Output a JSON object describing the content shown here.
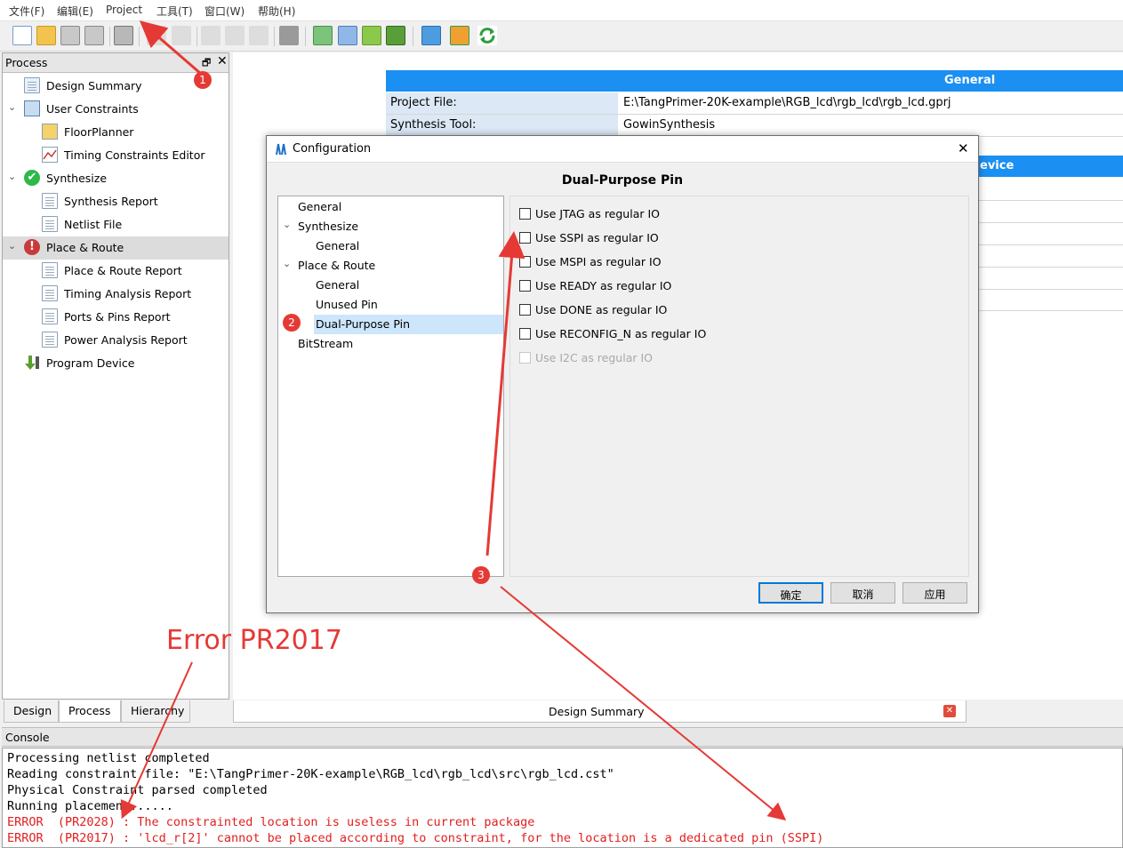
{
  "menu": [
    "文件(F)",
    "编辑(E)",
    "Project",
    "工具(T)",
    "窗口(W)",
    "帮助(H)"
  ],
  "process_panel": {
    "title": "Process",
    "items": [
      {
        "label": "Design Summary",
        "icon": "design-summary-icon"
      },
      {
        "label": "User Constraints",
        "icon": "constraints-icon"
      },
      {
        "label": "FloorPlanner",
        "icon": "floorplanner-icon"
      },
      {
        "label": "Timing Constraints Editor",
        "icon": "timing-editor-icon"
      },
      {
        "label": "Synthesize",
        "icon": "check-icon"
      },
      {
        "label": "Synthesis Report",
        "icon": "document-icon"
      },
      {
        "label": "Netlist File",
        "icon": "document-icon"
      },
      {
        "label": "Place & Route",
        "icon": "error-icon"
      },
      {
        "label": "Place & Route Report",
        "icon": "document-icon"
      },
      {
        "label": "Timing Analysis Report",
        "icon": "document-icon"
      },
      {
        "label": "Ports & Pins Report",
        "icon": "document-icon"
      },
      {
        "label": "Power Analysis Report",
        "icon": "document-icon"
      },
      {
        "label": "Program Device",
        "icon": "program-device-icon"
      }
    ]
  },
  "summary": {
    "general_header": "General",
    "device_header_partial": "evice",
    "rows": [
      {
        "key": "Project File:",
        "value": "E:\\TangPrimer-20K-example\\RGB_lcd\\rgb_lcd\\rgb_lcd.gprj"
      },
      {
        "key": "Synthesis Tool:",
        "value": "GowinSynthesis"
      }
    ]
  },
  "bottom_tabs": [
    "Design",
    "Process",
    "Hierarchy"
  ],
  "doc_tab": "Design Summary",
  "console": {
    "title": "Console",
    "lines": [
      {
        "text": "Processing netlist completed",
        "type": "info"
      },
      {
        "text": "Reading constraint file: \"E:\\TangPrimer-20K-example\\RGB_lcd\\rgb_lcd\\src\\rgb_lcd.cst\"",
        "type": "info"
      },
      {
        "text": "Physical Constraint parsed completed",
        "type": "info"
      },
      {
        "text": "Running placement......",
        "type": "info"
      },
      {
        "text": "ERROR  (PR2028) : The constrainted location is useless in current package",
        "type": "error"
      },
      {
        "text": "ERROR  (PR2017) : 'lcd_r[2]' cannot be placed according to constraint, for the location is a dedicated pin (SSPI)",
        "type": "error"
      }
    ]
  },
  "dialog": {
    "title": "Configuration",
    "heading": "Dual-Purpose Pin",
    "tree": [
      "General",
      "Synthesize",
      "General",
      "Place & Route",
      "General",
      "Unused Pin",
      "Dual-Purpose Pin",
      "BitStream"
    ],
    "options": [
      {
        "label": "Use JTAG as regular IO",
        "checked": false,
        "enabled": true
      },
      {
        "label": "Use SSPI as regular IO",
        "checked": false,
        "enabled": true
      },
      {
        "label": "Use MSPI as regular IO",
        "checked": false,
        "enabled": true
      },
      {
        "label": "Use READY as regular IO",
        "checked": false,
        "enabled": true
      },
      {
        "label": "Use DONE as regular IO",
        "checked": false,
        "enabled": true
      },
      {
        "label": "Use RECONFIG_N as regular IO",
        "checked": false,
        "enabled": true
      },
      {
        "label": "Use I2C as regular IO",
        "checked": false,
        "enabled": false
      }
    ],
    "buttons": {
      "ok": "确定",
      "cancel": "取消",
      "apply": "应用"
    }
  },
  "annotations": {
    "badge1": "1",
    "badge2": "2",
    "badge3": "3",
    "error_label": "Error PR2017",
    "color": "#e53935"
  }
}
